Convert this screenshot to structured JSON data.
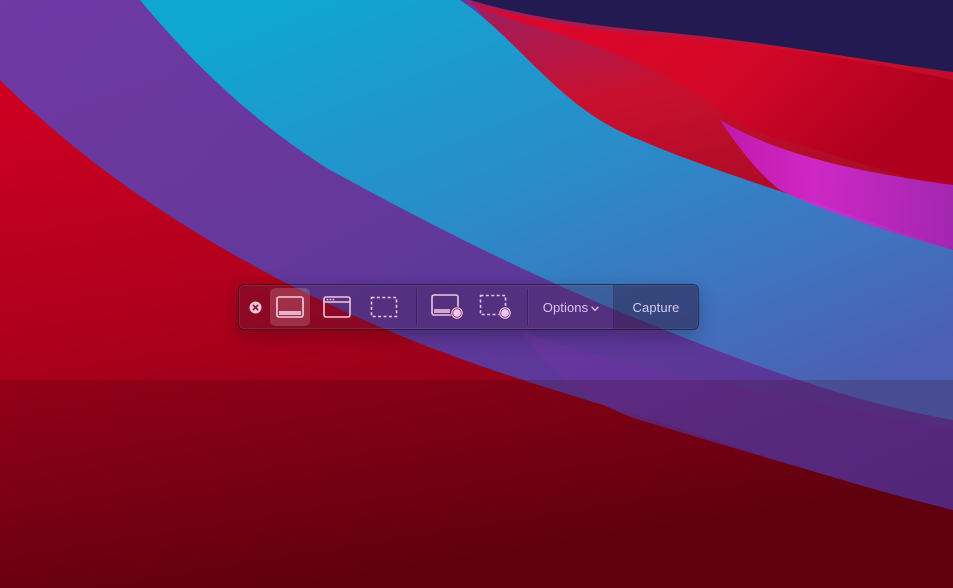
{
  "desktop": {
    "wallpaper_icon": "macos-big-sur-wallpaper"
  },
  "toolbar": {
    "buttons": [
      {
        "icon": "close-icon",
        "label": ""
      },
      {
        "icon": "capture-entire-screen-icon",
        "label": "",
        "selected": true
      },
      {
        "icon": "capture-window-icon",
        "label": ""
      },
      {
        "icon": "capture-selection-icon",
        "label": ""
      },
      {
        "icon": "record-entire-screen-icon",
        "label": ""
      },
      {
        "icon": "record-selection-icon",
        "label": ""
      }
    ],
    "options_label": "Options",
    "options_icon": "chevron-down-icon",
    "capture_label": "Capture"
  },
  "colors": {
    "icon_stroke": "#f3c6dc",
    "options_text": "#e4c8ff",
    "record_dot": "#f0c6f2"
  }
}
